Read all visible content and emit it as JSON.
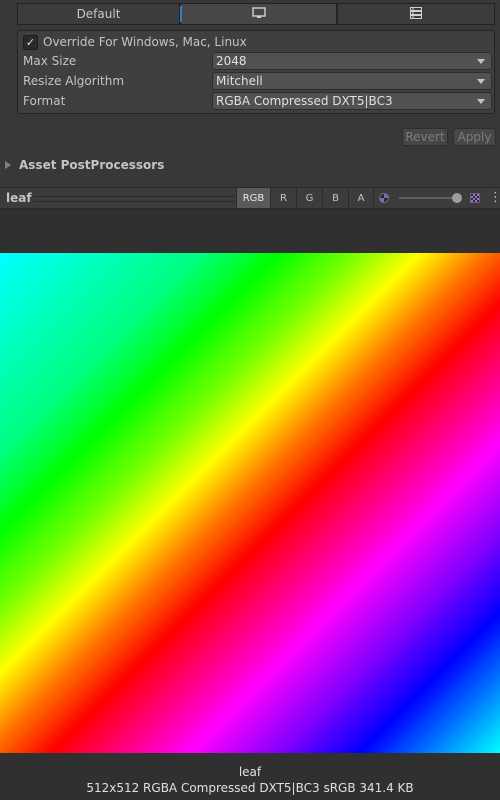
{
  "platform_tabs": {
    "default_label": "Default",
    "standalone_icon": "monitor-icon",
    "server_icon": "server-icon"
  },
  "override": {
    "checkbox_label": "Override For Windows, Mac, Linux",
    "checked": true,
    "max_size": {
      "label": "Max Size",
      "value": "2048"
    },
    "resize_algorithm": {
      "label": "Resize Algorithm",
      "value": "Mitchell"
    },
    "format": {
      "label": "Format",
      "value": "RGBA Compressed DXT5|BC3"
    }
  },
  "actions": {
    "revert": "Revert",
    "apply": "Apply"
  },
  "post_processors": {
    "label": "Asset PostProcessors"
  },
  "preview": {
    "title": "leaf",
    "channels": [
      "RGB",
      "R",
      "G",
      "B",
      "A"
    ],
    "active_channel": "RGB",
    "info_name": "leaf",
    "info_details": "512x512  RGBA Compressed DXT5|BC3 sRGB   341.4 KB"
  }
}
